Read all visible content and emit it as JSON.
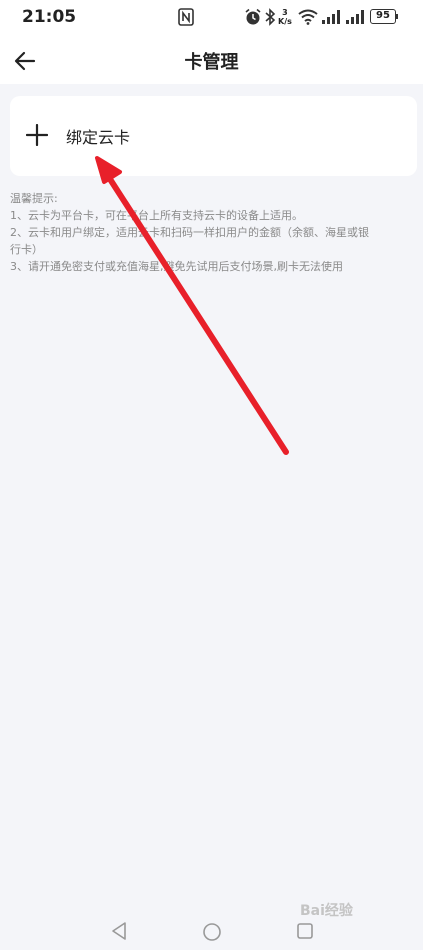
{
  "status_bar": {
    "time": "21:05",
    "net_speed_value": "3",
    "net_speed_unit": "K/s",
    "battery": "95",
    "icons": [
      "nfc-icon",
      "alarm-icon",
      "bluetooth-icon",
      "wifi-icon",
      "signal-icon",
      "signal-icon",
      "battery-icon"
    ]
  },
  "header": {
    "title": "卡管理",
    "back_icon": "back-arrow-icon"
  },
  "bind_card": {
    "icon": "plus-icon",
    "label": "绑定云卡"
  },
  "tips": {
    "heading": "温馨提示:",
    "items": [
      "1、云卡为平台卡，可在平台上所有支持云卡的设备上适用。",
      "2、云卡和用户绑定，适用云卡和扫码一样扣用户的金额（余额、海星或银",
      "行卡）",
      "3、请开通免密支付或充值海星,避免先试用后支付场景,刷卡无法使用"
    ]
  },
  "annotation": {
    "color": "#e8202a"
  },
  "nav_bar": {
    "icons": [
      "nav-back-icon",
      "nav-home-icon",
      "nav-recent-icon"
    ]
  },
  "watermark": "Bai经验"
}
